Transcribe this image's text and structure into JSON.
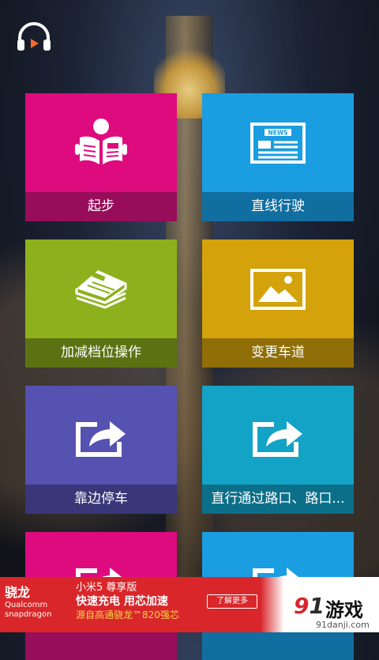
{
  "colors": {
    "pink": "#de0b7f",
    "pink_label": "#980d5a",
    "blue": "#1a9de1",
    "blue_label": "#116ea1",
    "green": "#8db11c",
    "green_label": "#5b7212",
    "gold": "#d4a30b",
    "gold_label": "#8f6e07",
    "purple": "#5552b1",
    "purple_label": "#39377a",
    "teal": "#13a3c7",
    "teal_label": "#0c6f8a"
  },
  "header": {
    "icon": "headphones-play-icon"
  },
  "tiles": [
    {
      "label": "起步",
      "icon": "newspaper-reader-icon",
      "color": "pink"
    },
    {
      "label": "直线行驶",
      "icon": "news-icon",
      "color": "blue"
    },
    {
      "label": "加减档位操作",
      "icon": "newspaper-stack-icon",
      "color": "green"
    },
    {
      "label": "变更车道",
      "icon": "image-icon",
      "color": "gold"
    },
    {
      "label": "靠边停车",
      "icon": "share-arrow-icon",
      "color": "purple"
    },
    {
      "label": "直行通过路口、路口...",
      "icon": "share-arrow-icon",
      "color": "teal"
    },
    {
      "label": "",
      "icon": "share-arrow-icon",
      "color": "pink"
    },
    {
      "label": "",
      "icon": "share-arrow-icon",
      "color": "blue"
    }
  ],
  "news_badge": "NEWS",
  "ad": {
    "brand": "骁龙",
    "sub_line1": "Qualcomm",
    "sub_line2": "snapdragon",
    "line1": "小米5 尊享版",
    "line2": "快速充电 用芯加速",
    "line3": "源自高通骁龙™820强芯",
    "button": "了解更多",
    "logo_num": "9",
    "logo_num2": "1",
    "logo_text": "游戏",
    "logo_url": "91danji.com"
  }
}
